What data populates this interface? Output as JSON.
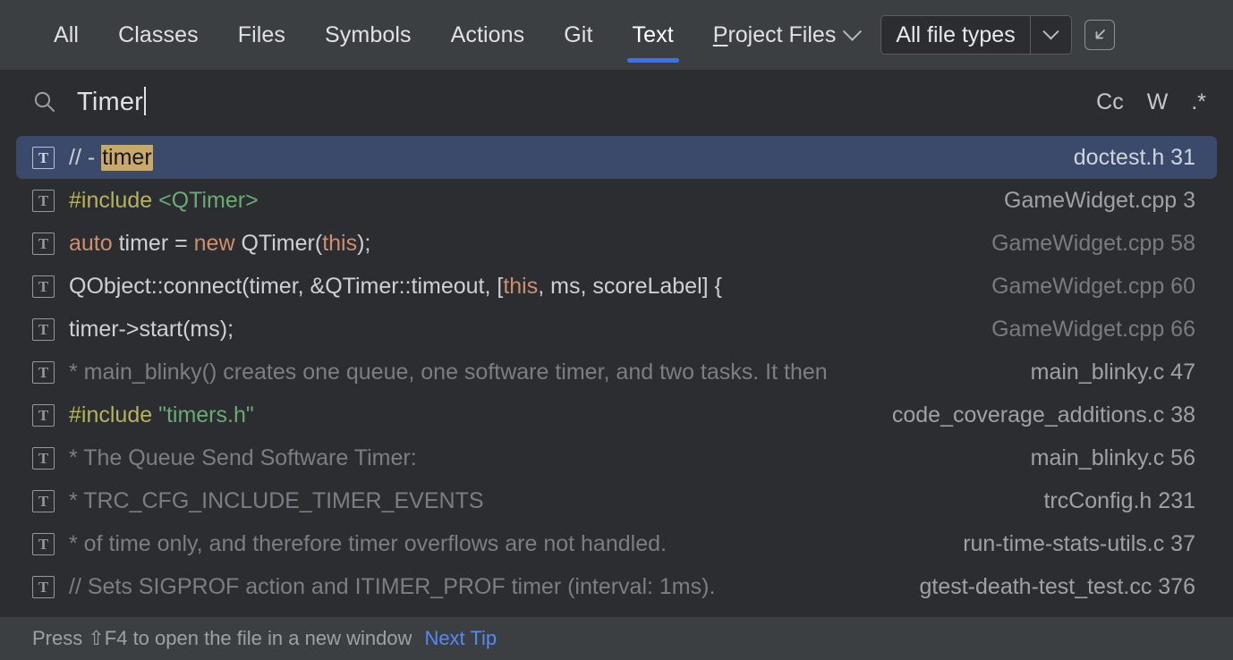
{
  "tabs": [
    {
      "label": "All",
      "active": false
    },
    {
      "label": "Classes",
      "active": false
    },
    {
      "label": "Files",
      "active": false
    },
    {
      "label": "Symbols",
      "active": false
    },
    {
      "label": "Actions",
      "active": false
    },
    {
      "label": "Git",
      "active": false
    },
    {
      "label": "Text",
      "active": true
    }
  ],
  "scope": {
    "mnemonic": "P",
    "rest": "roject Files",
    "full_label": "Project Files",
    "chevron_icon": "chevron-down-icon"
  },
  "file_types": {
    "value": "All file types",
    "chevron_icon": "chevron-down-icon"
  },
  "expand_button": {
    "icon": "arrow-down-left-icon"
  },
  "search": {
    "icon": "search-icon",
    "value": "Timer",
    "placeholder": "Type to search",
    "options": [
      {
        "id": "match-case",
        "label": "Cc"
      },
      {
        "id": "whole-words",
        "label": "W"
      },
      {
        "id": "regex",
        "label": ".*"
      }
    ]
  },
  "results": [
    {
      "selected": true,
      "icon": "text-match-icon",
      "location": "doctest.h 31",
      "location_bright": true,
      "tokens": [
        {
          "text": "// - ",
          "cls": "tok-plain"
        },
        {
          "text": "timer",
          "cls": "hl"
        }
      ]
    },
    {
      "selected": false,
      "icon": "text-match-icon",
      "location": "GameWidget.cpp 3",
      "location_bright": true,
      "tokens": [
        {
          "text": "#include ",
          "cls": "tok-macro"
        },
        {
          "text": "<QTimer>",
          "cls": "tok-str"
        }
      ]
    },
    {
      "selected": false,
      "icon": "text-match-icon",
      "location": "GameWidget.cpp 58",
      "location_bright": false,
      "tokens": [
        {
          "text": "auto ",
          "cls": "tok-kw"
        },
        {
          "text": "timer = ",
          "cls": "tok-plain"
        },
        {
          "text": "new ",
          "cls": "tok-kw"
        },
        {
          "text": "QTimer(",
          "cls": "tok-plain"
        },
        {
          "text": "this",
          "cls": "tok-kw"
        },
        {
          "text": ");",
          "cls": "tok-plain"
        }
      ]
    },
    {
      "selected": false,
      "icon": "text-match-icon",
      "location": "GameWidget.cpp 60",
      "location_bright": false,
      "tokens": [
        {
          "text": "QObject::connect(timer, &QTimer::timeout, [",
          "cls": "tok-plain"
        },
        {
          "text": "this",
          "cls": "tok-kw"
        },
        {
          "text": ", ms, scoreLabel] {",
          "cls": "tok-plain"
        }
      ]
    },
    {
      "selected": false,
      "icon": "text-match-icon",
      "location": "GameWidget.cpp 66",
      "location_bright": false,
      "tokens": [
        {
          "text": "timer->start(ms);",
          "cls": "tok-plain"
        }
      ]
    },
    {
      "selected": false,
      "icon": "text-match-icon",
      "location": "main_blinky.c 47",
      "location_bright": true,
      "tokens": [
        {
          "text": " * main_blinky() creates one queue, one software timer, and two tasks.  It then",
          "cls": "tok-comment"
        }
      ]
    },
    {
      "selected": false,
      "icon": "text-match-icon",
      "location": "code_coverage_additions.c 38",
      "location_bright": true,
      "tokens": [
        {
          "text": "#include ",
          "cls": "tok-macro"
        },
        {
          "text": "\"timers.h\"",
          "cls": "tok-str"
        }
      ]
    },
    {
      "selected": false,
      "icon": "text-match-icon",
      "location": "main_blinky.c 56",
      "location_bright": true,
      "tokens": [
        {
          "text": " * The Queue Send Software Timer:",
          "cls": "tok-comment"
        }
      ]
    },
    {
      "selected": false,
      "icon": "text-match-icon",
      "location": "trcConfig.h 231",
      "location_bright": true,
      "tokens": [
        {
          "text": " * TRC_CFG_INCLUDE_TIMER_EVENTS",
          "cls": "tok-comment"
        }
      ]
    },
    {
      "selected": false,
      "icon": "text-match-icon",
      "location": "run-time-stats-utils.c 37",
      "location_bright": true,
      "tokens": [
        {
          "text": " * of time only, and therefore timer overflows are not handled.",
          "cls": "tok-comment"
        }
      ]
    },
    {
      "selected": false,
      "icon": "text-match-icon",
      "location": "gtest-death-test_test.cc 376",
      "location_bright": true,
      "tokens": [
        {
          "text": "// Sets SIGPROF action and ITIMER_PROF timer (interval: 1ms).",
          "cls": "tok-comment"
        }
      ]
    }
  ],
  "status": {
    "tip_text": "Press ⇧F4 to open the file in a new window",
    "link_label": "Next Tip"
  },
  "colors": {
    "accent": "#3574F0",
    "tabbar_bg": "#3C3F41",
    "popup_bg": "#2B2D30",
    "selected_row": "#3B4A6B",
    "match_highlight": "#C9A86C",
    "link": "#548AF7"
  }
}
